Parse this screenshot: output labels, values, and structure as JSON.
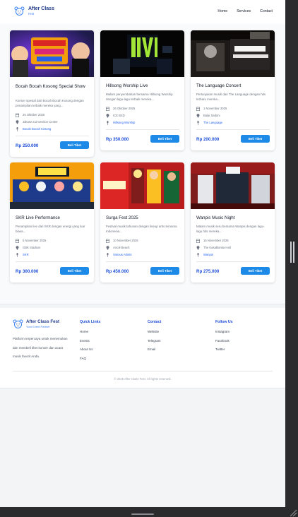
{
  "header": {
    "brand": "After Class",
    "brand_sub": "Fest",
    "nav": [
      "Home",
      "Services",
      "Contact"
    ]
  },
  "events": [
    {
      "title": "Bocah Bocah Kosong Special Show",
      "desc": "Konser spesial dari Bocah Bocah Kosong dengan penampilan terbaik mereka yang...",
      "date": "25 Oktober 2025",
      "venue": "Jakarta Convention Center",
      "artist": "Bocah Bocah Kosong",
      "price": "Rp 250.000",
      "button": "Beli Tiket"
    },
    {
      "title": "Hillsong Worship Live",
      "desc": "Malam penyembahan bersama Hillsong Worship dengan lagu-lagu terbaik mereka...",
      "date": "26 Oktober 2025",
      "venue": "ICE BSD",
      "artist": "Hillsong Worship",
      "price": "Rp 350.000",
      "button": "Beli Tiket"
    },
    {
      "title": "The Language Concert",
      "desc": "Pertunjukan musik dari The Language dengan hits terbaru mereka...",
      "date": "1 November 2025",
      "venue": "Balai Sarbini",
      "artist": "The Language",
      "price": "Rp 200.000",
      "button": "Beli Tiket"
    },
    {
      "title": "SKR Live Performance",
      "desc": "Penampilan live dari SKR dengan energi yang luar biasa...",
      "date": "5 November 2025",
      "venue": "GBK Stadium",
      "artist": "SKR",
      "price": "Rp 300.000",
      "button": "Beli Tiket"
    },
    {
      "title": "Surga Fest 2025",
      "desc": "Festival musik tahunan dengan lineup artis ternama Indonesia...",
      "date": "10 November 2025",
      "venue": "Ancol Beach",
      "artist": "Various Artists",
      "price": "Rp 450.000",
      "button": "Beli Tiket"
    },
    {
      "title": "Wanpis Music Night",
      "desc": "Malam musik seru bersama Wanpis dengan lagu-lagu hits mereka...",
      "date": "15 November 2025",
      "venue": "The Kasablanka Hall",
      "artist": "Wanpis",
      "price": "Rp 275.000",
      "button": "Beli Tiket"
    }
  ],
  "footer": {
    "brand": "After Class Fest",
    "brand_sub": "Your Event Partner",
    "about": "Platform terpercaya untuk menemukan dan membeli tiket konser dan acara musik favorit Anda.",
    "quick_links_title": "Quick Links",
    "quick_links": [
      "Home",
      "Events",
      "About Us",
      "FAQ"
    ],
    "contact_title": "Contact",
    "contact": [
      "Website",
      "Telegram",
      "Email"
    ],
    "follow_title": "Follow Us",
    "follow": [
      "Instagram",
      "Facebook",
      "Twitter"
    ],
    "copyright": "© 2025 After Class Fest. All rights reserved."
  },
  "colors": {
    "accent": "#1d8ae8",
    "price": "#1d4ed8",
    "brand_dark": "#1f3a8a"
  }
}
